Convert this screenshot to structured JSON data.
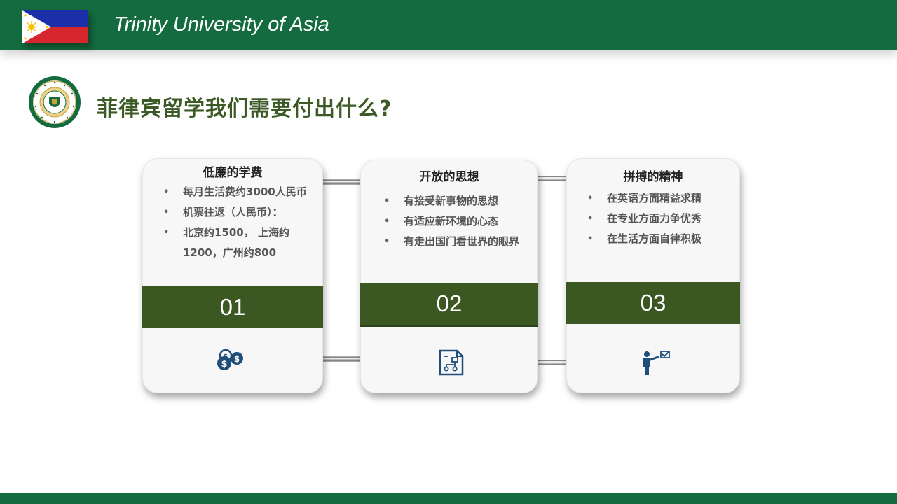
{
  "header": {
    "brand": "Trinity University of Asia",
    "flag_colors": {
      "blue": "#1a2fa8",
      "red": "#d8262f",
      "white": "#ffffff",
      "sun": "#f2c400"
    }
  },
  "title": "菲律宾留学我们需要付出什么?",
  "colors": {
    "green": "#136b3f",
    "band": "#3b5722",
    "title": "#3b5a25",
    "icon": "#1f4e7a"
  },
  "cards": [
    {
      "title": "低廉的学费",
      "items": [
        "每月生活费约3000人民币",
        "机票往返（人民币）：",
        "北京约1500， 上海约1200，广州约800"
      ],
      "number": "01",
      "icon": "money-coins-icon"
    },
    {
      "title": "开放的思想",
      "items": [
        "有接受新事物的思想",
        "有适应新环境的心态",
        "有走出国门看世界的眼界"
      ],
      "number": "02",
      "icon": "flowchart-document-icon"
    },
    {
      "title": "拼搏的精神",
      "items": [
        "在英语方面精益求精",
        "在专业方面力争优秀",
        "在生活方面自律积极"
      ],
      "number": "03",
      "icon": "presenter-checklist-icon"
    }
  ]
}
